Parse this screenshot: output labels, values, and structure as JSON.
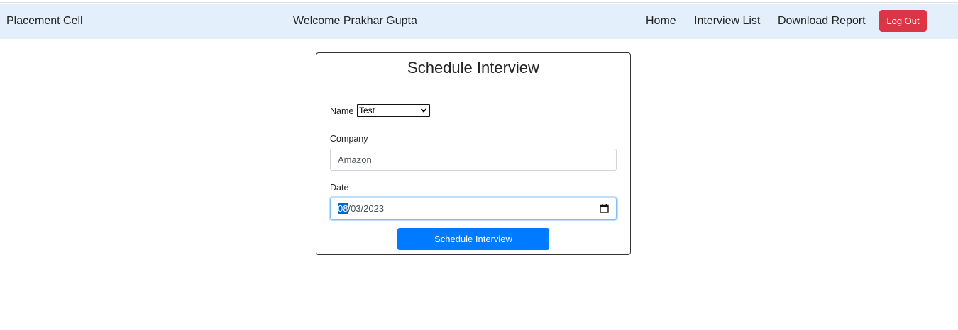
{
  "navbar": {
    "brand": "Placement Cell",
    "welcome": "Welcome Prakhar Gupta",
    "links": {
      "home": "Home",
      "interview_list": "Interview List",
      "download_report": "Download Report"
    },
    "logout_label": "Log Out"
  },
  "form": {
    "title": "Schedule Interview",
    "name_label": "Name",
    "name_selected": "Test",
    "company_label": "Company",
    "company_value": "Amazon",
    "date_label": "Date",
    "date_month": "08",
    "date_rest": "/03/2023",
    "submit_label": "Schedule Interview"
  },
  "colors": {
    "navbar_bg": "#e3f0fb",
    "logout_bg": "#dc3545",
    "primary": "#007bff"
  },
  "icons": {
    "select_chevron": "chevron-down-icon",
    "date_picker": "calendar-icon"
  }
}
